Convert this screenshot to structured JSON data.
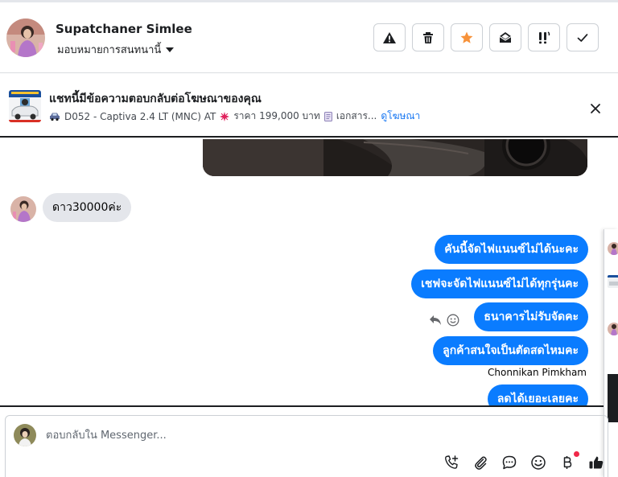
{
  "header": {
    "contact_name": "Supatchaner Simlee",
    "assign_label": "มอบหมายการสนทนานี้",
    "actions": [
      "report-icon",
      "trash-icon",
      "star-icon",
      "mark-unread-icon",
      "priority-icon",
      "done-check-icon"
    ],
    "star_color": "#f7923a"
  },
  "banner": {
    "title": "แชทนี้มีข้อความตอบกลับต่อโฆษณาของคุณ",
    "product": "D052 - Captiva 2.4 LT (MNC) AT",
    "price": "ราคา 199,000 บาท",
    "docs": "เอกสาร...",
    "view_ad": "ดูโฆษณา"
  },
  "chat": {
    "incoming": [
      {
        "text": "ดาว30000ค่ะ"
      }
    ],
    "outgoing": [
      {
        "text": "คันนี้จัดไฟแนนซ์ไม่ได้นะคะ"
      },
      {
        "text": "เชฟจะจัดไฟแนนซ์ไม่ได้ทุกรุ่นคะ"
      },
      {
        "text": "ธนาคารไม่รับจัดคะ"
      },
      {
        "text": "ลูกค้าสนใจเป็นตัดสดไหมคะ"
      },
      {
        "text": "ลดได้เยอะเลยคะ"
      }
    ],
    "sender_name": "Chonnikan Pimkham",
    "bubble_color": "#0a7cff"
  },
  "composer": {
    "placeholder": "ตอบกลับใน Messenger...",
    "tools": [
      "call-add-icon",
      "attachment-icon",
      "saved-replies-icon",
      "emoji-icon",
      "baht-payment-icon",
      "like-icon"
    ]
  }
}
